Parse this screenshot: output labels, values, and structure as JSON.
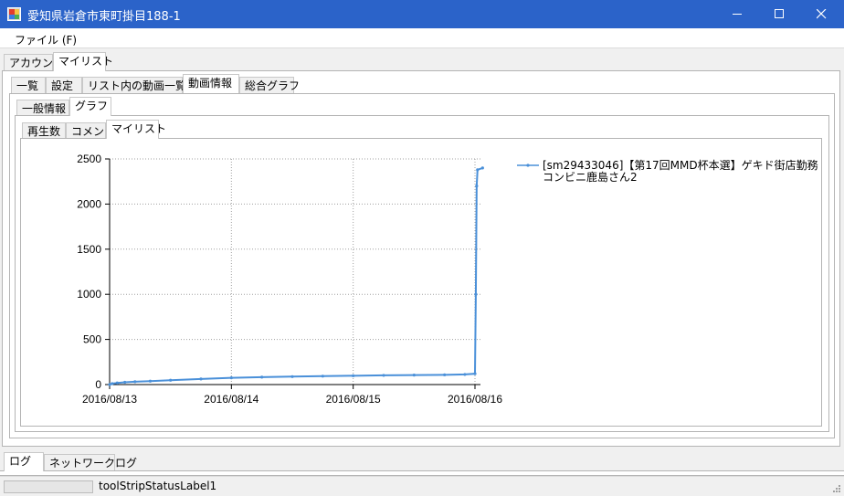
{
  "window": {
    "title": "愛知県岩倉市東町掛目188-1",
    "icon": "app-icon"
  },
  "menu": {
    "file": "ファイル (F)"
  },
  "tabs_top": [
    "アカウント",
    "マイリスト"
  ],
  "tabs_main": [
    "一覧",
    "設定",
    "リスト内の動画一覧",
    "動画情報",
    "総合グラフ"
  ],
  "tabs_info": [
    "一般情報",
    "グラフ"
  ],
  "tabs_graph": [
    "再生数",
    "コメント",
    "マイリスト"
  ],
  "tabs_bottom": [
    "ログ",
    "ネットワークログ"
  ],
  "status": {
    "label": "toolStripStatusLabel1",
    "progress": 0
  },
  "chart_data": {
    "type": "line",
    "x_ticks": [
      "2016/08/13",
      "2016/08/14",
      "2016/08/15",
      "2016/08/16"
    ],
    "y_ticks": [
      0,
      500,
      1000,
      1500,
      2000,
      2500
    ],
    "ylim": [
      0,
      2500
    ],
    "grid": true,
    "legend_position": "right",
    "series": [
      {
        "name": "[sm29433046]【第17回MMD杯本選】ゲキド街店勤務コンビニ鹿島さん2",
        "color": "#4a90d9",
        "points": [
          [
            "2016/08/13 00:00",
            0
          ],
          [
            "2016/08/13 00:30",
            10
          ],
          [
            "2016/08/13 01:30",
            18
          ],
          [
            "2016/08/13 03:00",
            25
          ],
          [
            "2016/08/13 05:00",
            32
          ],
          [
            "2016/08/13 08:00",
            38
          ],
          [
            "2016/08/13 12:00",
            48
          ],
          [
            "2016/08/13 18:00",
            62
          ],
          [
            "2016/08/14 00:00",
            75
          ],
          [
            "2016/08/14 06:00",
            82
          ],
          [
            "2016/08/14 12:00",
            88
          ],
          [
            "2016/08/14 18:00",
            93
          ],
          [
            "2016/08/15 00:00",
            98
          ],
          [
            "2016/08/15 06:00",
            102
          ],
          [
            "2016/08/15 12:00",
            105
          ],
          [
            "2016/08/15 18:00",
            108
          ],
          [
            "2016/08/15 22:00",
            112
          ],
          [
            "2016/08/16 00:00",
            120
          ],
          [
            "2016/08/16 00:10",
            1000
          ],
          [
            "2016/08/16 00:20",
            2200
          ],
          [
            "2016/08/16 00:30",
            2380
          ],
          [
            "2016/08/16 01:30",
            2400
          ]
        ]
      }
    ]
  }
}
